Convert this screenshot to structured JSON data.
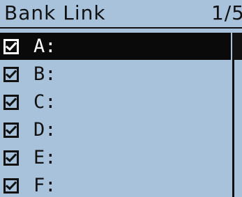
{
  "header": {
    "title": "Bank Link",
    "page_indicator": "1/5"
  },
  "list": {
    "items": [
      {
        "label": "A:",
        "checked": true,
        "selected": true
      },
      {
        "label": "B:",
        "checked": true,
        "selected": false
      },
      {
        "label": "C:",
        "checked": true,
        "selected": false
      },
      {
        "label": "D:",
        "checked": true,
        "selected": false
      },
      {
        "label": "E:",
        "checked": true,
        "selected": false
      },
      {
        "label": "F:",
        "checked": true,
        "selected": false
      }
    ]
  },
  "colors": {
    "screen_background": "#a9c2dc",
    "selected_row_background": "#0a0a0a",
    "text": "#111111",
    "selected_text": "#ffffff"
  },
  "icons": {
    "checkbox": "checkbox-checked-icon"
  }
}
